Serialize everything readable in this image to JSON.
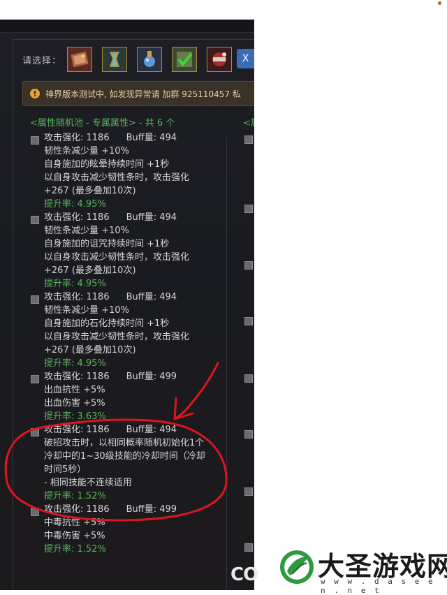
{
  "selector": {
    "label": "请选择：",
    "items": [
      {
        "name": "item-icon-1",
        "color": "#7a3a2a"
      },
      {
        "name": "item-icon-2",
        "color": "#3a5a5a"
      },
      {
        "name": "item-icon-3",
        "color": "#3a5a7a"
      },
      {
        "name": "item-icon-4",
        "color": "#4a6a2a"
      },
      {
        "name": "item-icon-5",
        "color": "#6a2a2a"
      }
    ],
    "close_label": "X"
  },
  "notice": {
    "icon": "!",
    "text": "神界版本测试中, 如发现异常请 加群 925110457 私"
  },
  "pool": {
    "header": "<属性随机池 - 专属属性> - 共 6 个",
    "header_right": "<属"
  },
  "entries": [
    {
      "attack": "攻击强化: 1186",
      "buff": "Buff量: 494",
      "lines": [
        "韧性条减少量 +10%",
        "自身施加的眩晕持续时间 +1秒",
        "以自身攻击减少韧性条时，攻击强化",
        "+267 (最多叠加10次)"
      ],
      "rate": "提升率: 4.95%"
    },
    {
      "attack": "攻击强化: 1186",
      "buff": "Buff量: 494",
      "lines": [
        "韧性条减少量 +10%",
        "自身施加的诅咒持续时间 +1秒",
        "以自身攻击减少韧性条时，攻击强化",
        "+267 (最多叠加10次)"
      ],
      "rate": "提升率: 4.95%"
    },
    {
      "attack": "攻击强化: 1186",
      "buff": "Buff量: 494",
      "lines": [
        "韧性条减少量 +10%",
        "自身施加的石化持续时间 +1秒",
        "以自身攻击减少韧性条时，攻击强化",
        "+267 (最多叠加10次)"
      ],
      "rate": "提升率: 4.95%"
    },
    {
      "attack": "攻击强化: 1186",
      "buff": "Buff量: 499",
      "lines": [
        "出血抗性 +5%",
        "出血伤害 +5%"
      ],
      "rate": "提升率: 3.63%"
    },
    {
      "attack": "攻击强化: 1186",
      "buff": "Buff量: 494",
      "lines": [
        "破招攻击时，以相同概率随机初始化1个",
        "冷却中的1~30级技能的冷却时间（冷却",
        "时间5秒）",
        "- 相同技能不连续适用"
      ],
      "rate": "提升率: 1.52%"
    },
    {
      "attack": "攻击强化: 1186",
      "buff": "Buff量: 499",
      "lines": [
        "中毒抗性 +5%",
        "中毒伤害 +5%"
      ],
      "rate": "提升率: 1.52%"
    }
  ],
  "watermark": {
    "title": "大圣游戏网",
    "url": "w w w . d a s e e n . n e t",
    "co": "CO"
  },
  "colors": {
    "accent_green": "#58b35a",
    "annotation_red": "#e0141e",
    "close_blue": "#3a6bb8"
  }
}
